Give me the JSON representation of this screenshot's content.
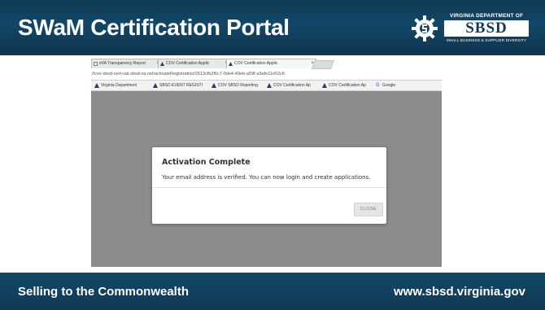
{
  "slide": {
    "title": "SWaM Certification Portal",
    "footer_left": "Selling to the Commonwealth",
    "footer_right": "www.sbsd.virginia.gov",
    "colors": {
      "header_bg": "#124767",
      "footer_bg": "#0f3a56",
      "title_text": "#ffffff"
    }
  },
  "logo": {
    "top_text": "VIRGINIA DEPARTMENT OF",
    "main_text": "SBSD",
    "bottom_text": "SMALL BUSINESS & SUPPLIER DIVERSITY",
    "icon": "gear-icon"
  },
  "browser": {
    "tabs": [
      {
        "label": "eVA Transparency Report",
        "icon": "document-icon",
        "active": false
      },
      {
        "label": "COV Certification Applic",
        "icon": "virginia-logo-icon",
        "active": false
      },
      {
        "label": "COV Certification Applic",
        "icon": "virginia-logo-icon",
        "active": true
      }
    ],
    "url": "//cov-sbsd-cert-uat.sbsd-va.net/activateRegistration/2613cfb2f6c7-0de4-49eb-a59f-a9afe11e52c6",
    "bookmarks": [
      {
        "label": "Virginia Department",
        "icon": "virginia-logo-icon"
      },
      {
        "label": "SBSD EVENT REGISTI",
        "icon": "virginia-logo-icon"
      },
      {
        "label": "COV SBSD Reporting",
        "icon": "virginia-logo-icon"
      },
      {
        "label": "COV Certification Ap",
        "icon": "virginia-logo-icon"
      },
      {
        "label": "COV Certification Ap",
        "icon": "virginia-logo-icon"
      },
      {
        "label": "Google",
        "icon": "google-icon"
      }
    ]
  },
  "modal": {
    "title": "Activation Complete",
    "message": "Your email address is verified. You can now login and create applications.",
    "close_label": "CLOSE"
  }
}
